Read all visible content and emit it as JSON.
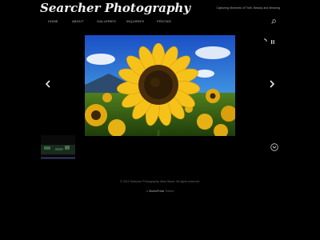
{
  "site": {
    "title": "Searcher Photography",
    "tagline": "Capturing Moments of Truth, Beauty and Meaning"
  },
  "nav": {
    "items": [
      {
        "label": "HOME"
      },
      {
        "label": "ABOUT"
      },
      {
        "label": "GALLERIES"
      },
      {
        "label": "INQUIRIES"
      },
      {
        "label": "PRICING"
      }
    ]
  },
  "icons": {
    "search": "search-icon",
    "prev": "chevron-left-icon",
    "next": "chevron-right-icon",
    "loading": "loading-spinner-icon",
    "pause": "pause-icon",
    "down": "chevron-down-circle-icon"
  },
  "slider": {
    "image_alt": "sunflower photo"
  },
  "footer": {
    "copyright": "© 2014 Searcher Photography. Allan Bauer. All rights reserved.",
    "credit_prefix": "A",
    "credit_brand": "StudioPress",
    "credit_suffix": "Theme"
  },
  "colors": {
    "background": "#000000",
    "text": "#9a9a9a",
    "title": "#f2f2f2"
  }
}
